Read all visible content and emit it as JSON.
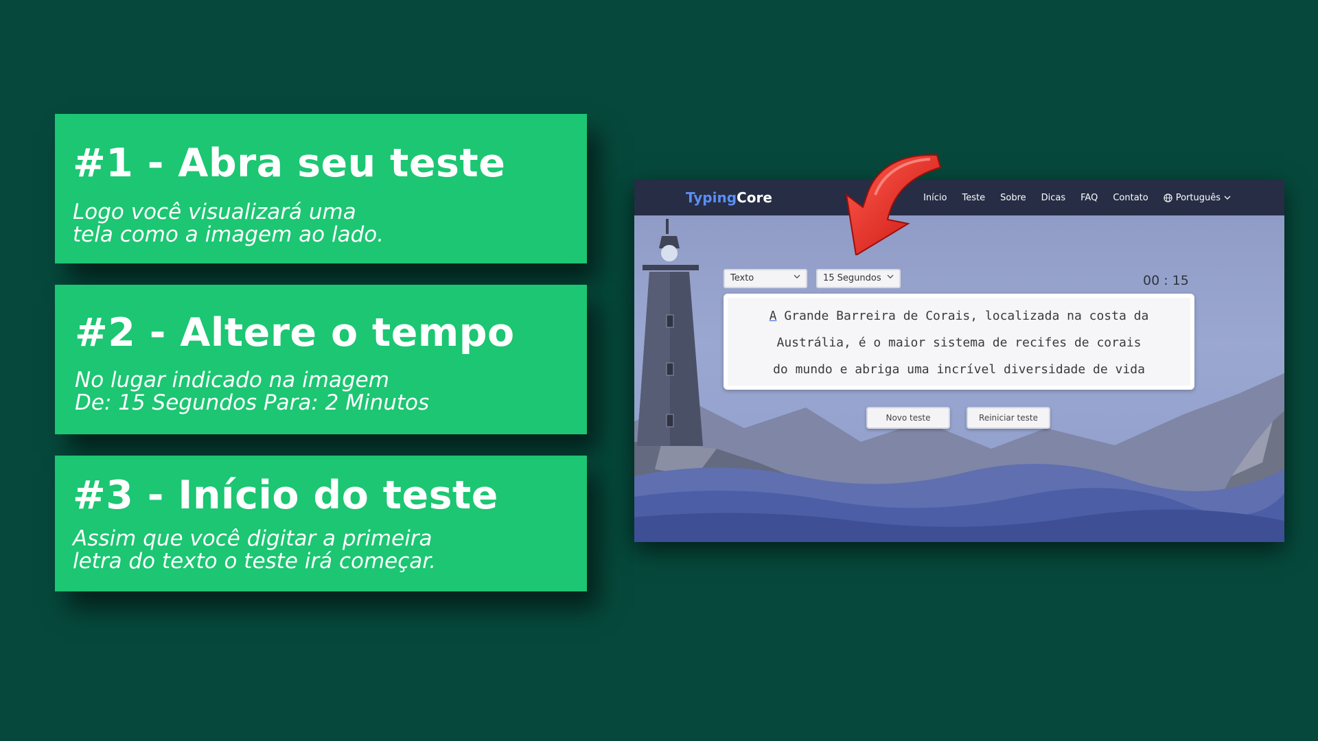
{
  "steps": [
    {
      "title": "#1 - Abra seu teste",
      "text": "Logo você visualizará uma\ntela como a imagem ao lado."
    },
    {
      "title": "#2 - Altere o tempo",
      "text": "No lugar indicado na imagem\nDe: 15 Segundos Para: 2 Minutos"
    },
    {
      "title": "#3 - Início do teste",
      "text": "Assim que você digitar a primeira\nletra do texto o teste irá começar."
    }
  ],
  "app": {
    "logo_part1": "Typing",
    "logo_part2": "Core",
    "nav": [
      "Início",
      "Teste",
      "Sobre",
      "Dicas",
      "FAQ",
      "Contato"
    ],
    "language": "Português",
    "mode_select": "Texto",
    "time_select": "15 Segundos",
    "timer": "00 : 15",
    "text_first_letter": "A",
    "text_rest": " Grande Barreira de Corais, localizada na costa da\nAustrália, é o maior sistema de recifes de corais\ndo mundo e abriga uma incrível diversidade de vida",
    "buttons": {
      "new_test": "Novo teste",
      "restart_test": "Reiniciar teste"
    }
  },
  "colors": {
    "background": "#06493c",
    "step_panel": "#1cc672",
    "nav_bar": "#262d45",
    "logo_accent": "#5b8ef5",
    "arrow": "#e8261f"
  },
  "icons": {
    "language": "globe-icon",
    "dropdown": "chevron-down-icon",
    "pointer": "curved-arrow-icon"
  }
}
